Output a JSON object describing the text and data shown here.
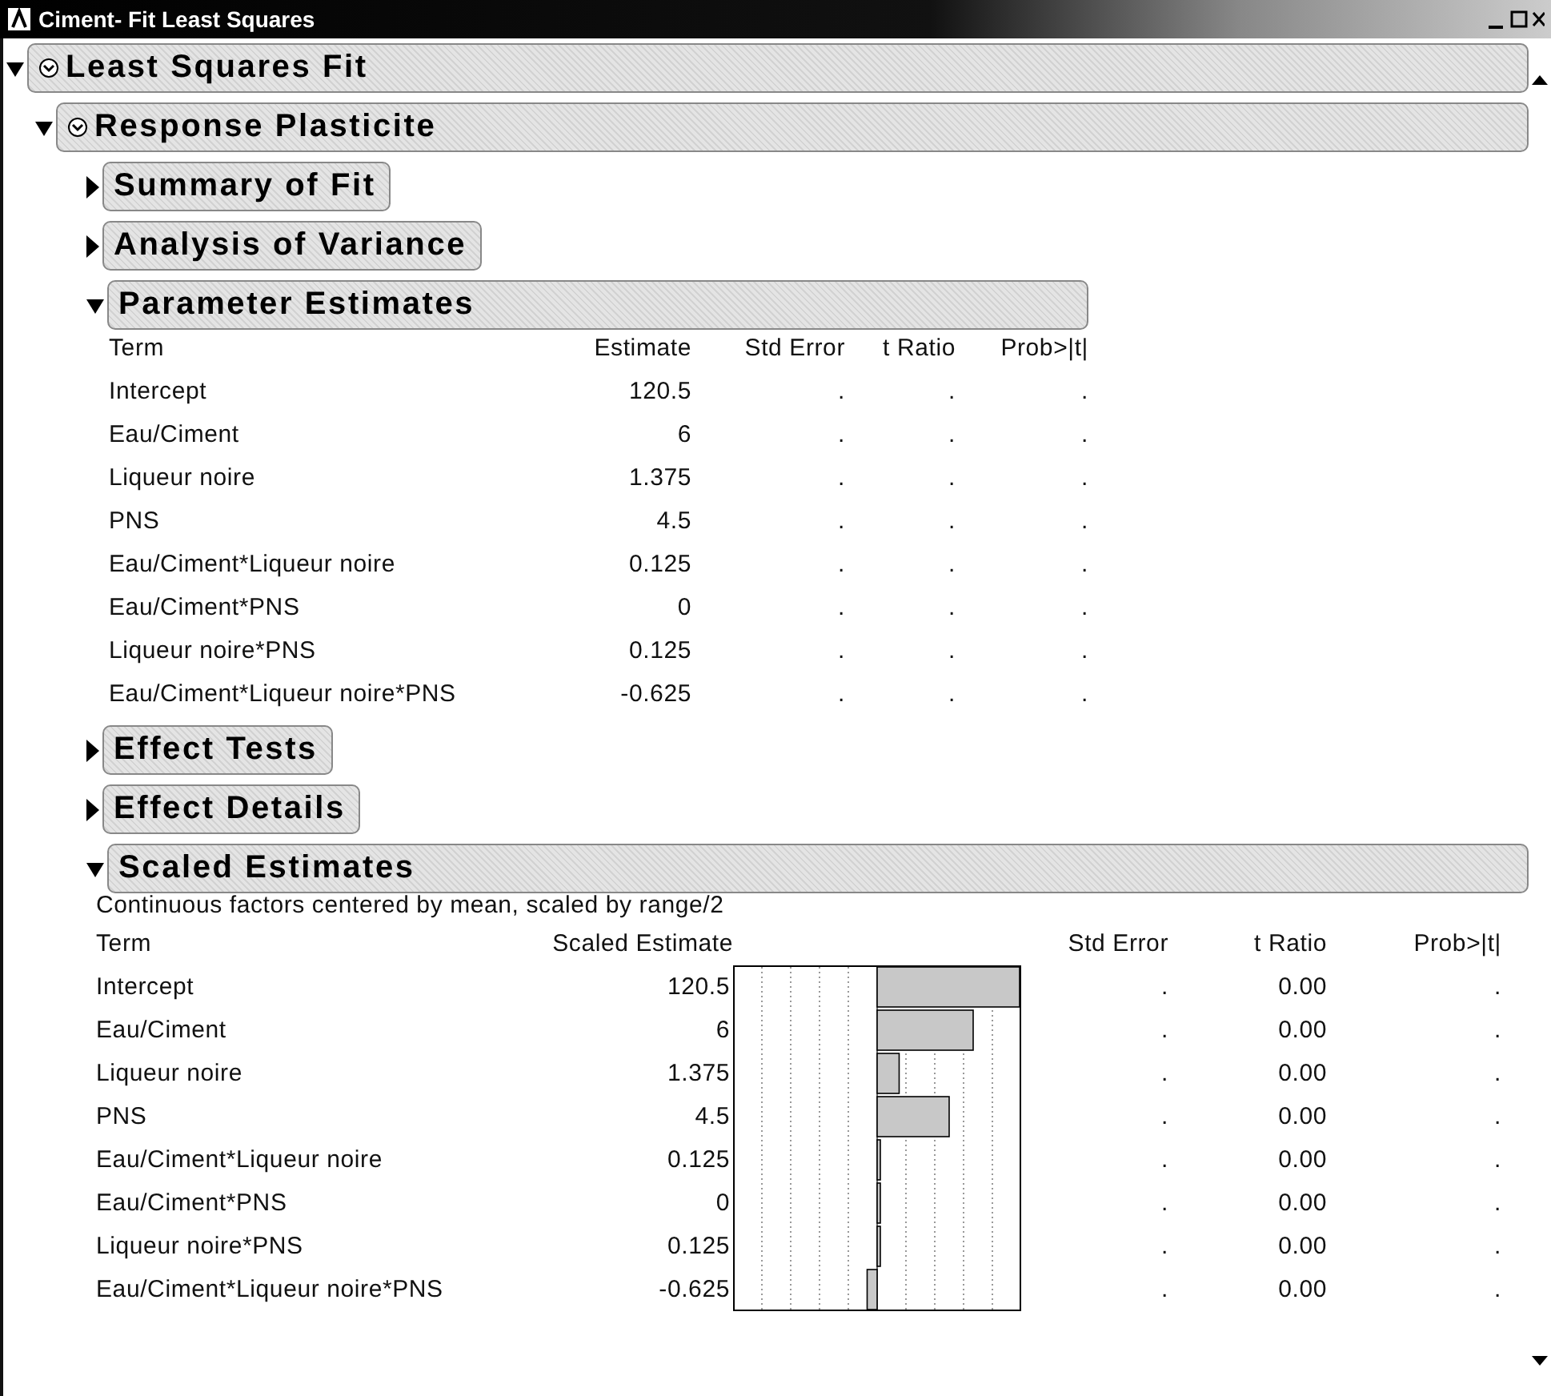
{
  "window": {
    "title": "Ciment- Fit Least Squares"
  },
  "outline": [
    {
      "title": "Least Squares Fit",
      "expanded": true,
      "has_menu": true,
      "children": [
        {
          "title": "Response Plasticite",
          "expanded": true,
          "has_menu": true,
          "children": [
            {
              "title": "Summary of Fit",
              "expanded": false
            },
            {
              "title": "Analysis of Variance",
              "expanded": false
            },
            {
              "title": "Parameter Estimates",
              "expanded": true,
              "table": {
                "kind": "plain",
                "columns": [
                  "Term",
                  "Estimate",
                  "Std Error",
                  "t Ratio",
                  "Prob>|t|"
                ],
                "rows": [
                  [
                    "Intercept",
                    "120.5",
                    ".",
                    ".",
                    "."
                  ],
                  [
                    "Eau/Ciment",
                    "6",
                    ".",
                    ".",
                    "."
                  ],
                  [
                    "Liqueur noire",
                    "1.375",
                    ".",
                    ".",
                    "."
                  ],
                  [
                    "PNS",
                    "4.5",
                    ".",
                    ".",
                    "."
                  ],
                  [
                    "Eau/Ciment*Liqueur noire",
                    "0.125",
                    ".",
                    ".",
                    "."
                  ],
                  [
                    "Eau/Ciment*PNS",
                    "0",
                    ".",
                    ".",
                    "."
                  ],
                  [
                    "Liqueur noire*PNS",
                    "0.125",
                    ".",
                    ".",
                    "."
                  ],
                  [
                    "Eau/Ciment*Liqueur noire*PNS",
                    "-0.625",
                    ".",
                    ".",
                    "."
                  ]
                ]
              }
            },
            {
              "title": "Effect Tests",
              "expanded": false
            },
            {
              "title": "Effect Details",
              "expanded": false
            },
            {
              "title": "Scaled Estimates",
              "expanded": true,
              "note": "Continuous factors centered by mean, scaled by range/2",
              "table": {
                "kind": "bars",
                "columns": [
                  "Term",
                  "Scaled Estimate",
                  "Std Error",
                  "t Ratio",
                  "Prob>|t|"
                ],
                "rows": [
                  [
                    "Intercept",
                    "120.5",
                    ".",
                    "0.00",
                    "."
                  ],
                  [
                    "Eau/Ciment",
                    "6",
                    ".",
                    "0.00",
                    "."
                  ],
                  [
                    "Liqueur noire",
                    "1.375",
                    ".",
                    "0.00",
                    "."
                  ],
                  [
                    "PNS",
                    "4.5",
                    ".",
                    "0.00",
                    "."
                  ],
                  [
                    "Eau/Ciment*Liqueur noire",
                    "0.125",
                    ".",
                    "0.00",
                    "."
                  ],
                  [
                    "Eau/Ciment*PNS",
                    "0",
                    ".",
                    "0.00",
                    "."
                  ],
                  [
                    "Liqueur noire*PNS",
                    "0.125",
                    ".",
                    "0.00",
                    "."
                  ],
                  [
                    "Eau/Ciment*Liqueur noire*PNS",
                    "-0.625",
                    ".",
                    "0.00",
                    "."
                  ]
                ]
              }
            }
          ]
        }
      ]
    }
  ]
}
